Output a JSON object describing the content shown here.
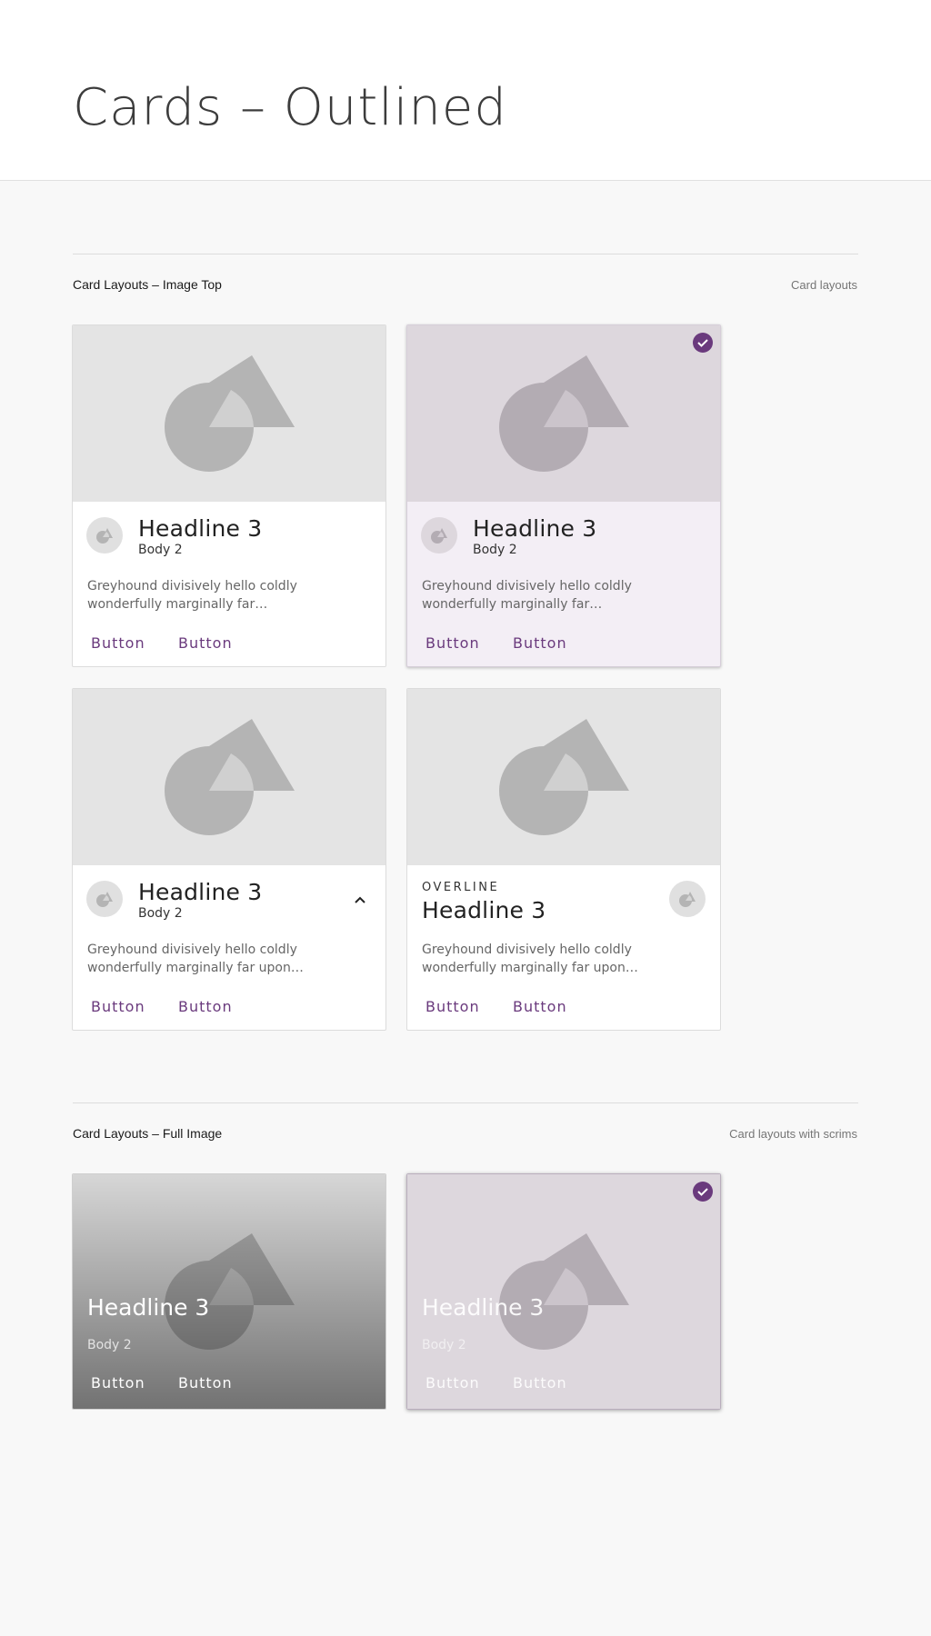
{
  "page": {
    "title": "Cards – Outlined"
  },
  "colors": {
    "accent": "#6a3a7d",
    "selected_surface": "#f3eef5",
    "media_gray": "#e4e4e4",
    "shape_gray": "#b4b4b4"
  },
  "sections": [
    {
      "title": "Card Layouts – Image Top",
      "note": "Card layouts"
    },
    {
      "title": "Card Layouts – Full Image",
      "note": "Card layouts with scrims"
    }
  ],
  "image_top_cards": [
    {
      "headline": "Headline 3",
      "subtitle": "Body 2",
      "description": "Greyhound divisively hello coldly wonderfully marginally far…",
      "buttons": [
        "Button",
        "Button"
      ],
      "selected": false,
      "icon": "image-placeholder-icon"
    },
    {
      "headline": "Headline 3",
      "subtitle": "Body 2",
      "description": "Greyhound divisively hello coldly wonderfully marginally far…",
      "buttons": [
        "Button",
        "Button"
      ],
      "selected": true,
      "icon": "check-circle-icon"
    },
    {
      "headline": "Headline 3",
      "subtitle": "Body 2",
      "description": "Greyhound divisively hello coldly wonderfully marginally far upon…",
      "buttons": [
        "Button",
        "Button"
      ],
      "selected": false,
      "icon": "chevron-up-icon"
    },
    {
      "overline": "OVERLINE",
      "headline": "Headline 3",
      "description": "Greyhound divisively hello coldly wonderfully marginally far upon…",
      "buttons": [
        "Button",
        "Button"
      ],
      "selected": false,
      "icon": "image-placeholder-icon"
    }
  ],
  "full_image_cards": [
    {
      "headline": "Headline 3",
      "subtitle": "Body 2",
      "buttons": [
        "Button",
        "Button"
      ],
      "selected": false
    },
    {
      "headline": "Headline 3",
      "subtitle": "Body 2",
      "buttons": [
        "Button",
        "Button"
      ],
      "selected": true,
      "icon": "check-circle-icon"
    }
  ]
}
